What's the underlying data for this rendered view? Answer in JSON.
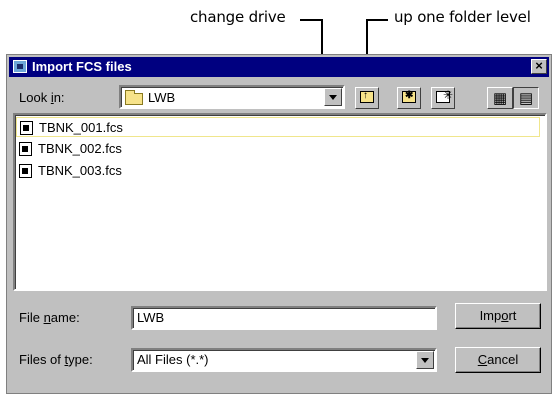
{
  "callouts": {
    "change_drive": "change drive",
    "up_one_level": "up one folder level"
  },
  "dialog": {
    "title": "Import FCS files",
    "close_glyph": "×"
  },
  "look_in": {
    "label_pre": "Look ",
    "label_ul": "i",
    "label_post": "n:",
    "value": "LWB"
  },
  "toolbar": {
    "up_glyph": "↑",
    "desktop_glyph": "✱",
    "new_folder_glyph": "✳",
    "list_view_glyph": "▦",
    "details_view_glyph": "▤"
  },
  "files": [
    "TBNK_001.fcs",
    "TBNK_002.fcs",
    "TBNK_003.fcs"
  ],
  "filename": {
    "label_pre": "File ",
    "label_ul": "n",
    "label_post": "ame:",
    "value": "LWB"
  },
  "filetype": {
    "label_pre": "Files of ",
    "label_ul": "t",
    "label_post": "ype:",
    "value": "All Files (*.*)"
  },
  "buttons": {
    "import_pre": "Imp",
    "import_ul": "o",
    "import_post": "rt",
    "cancel_ul": "C",
    "cancel_post": "ancel"
  },
  "colors": {
    "titlebar": "#000080",
    "dialog_bg": "#c0c0c0"
  }
}
